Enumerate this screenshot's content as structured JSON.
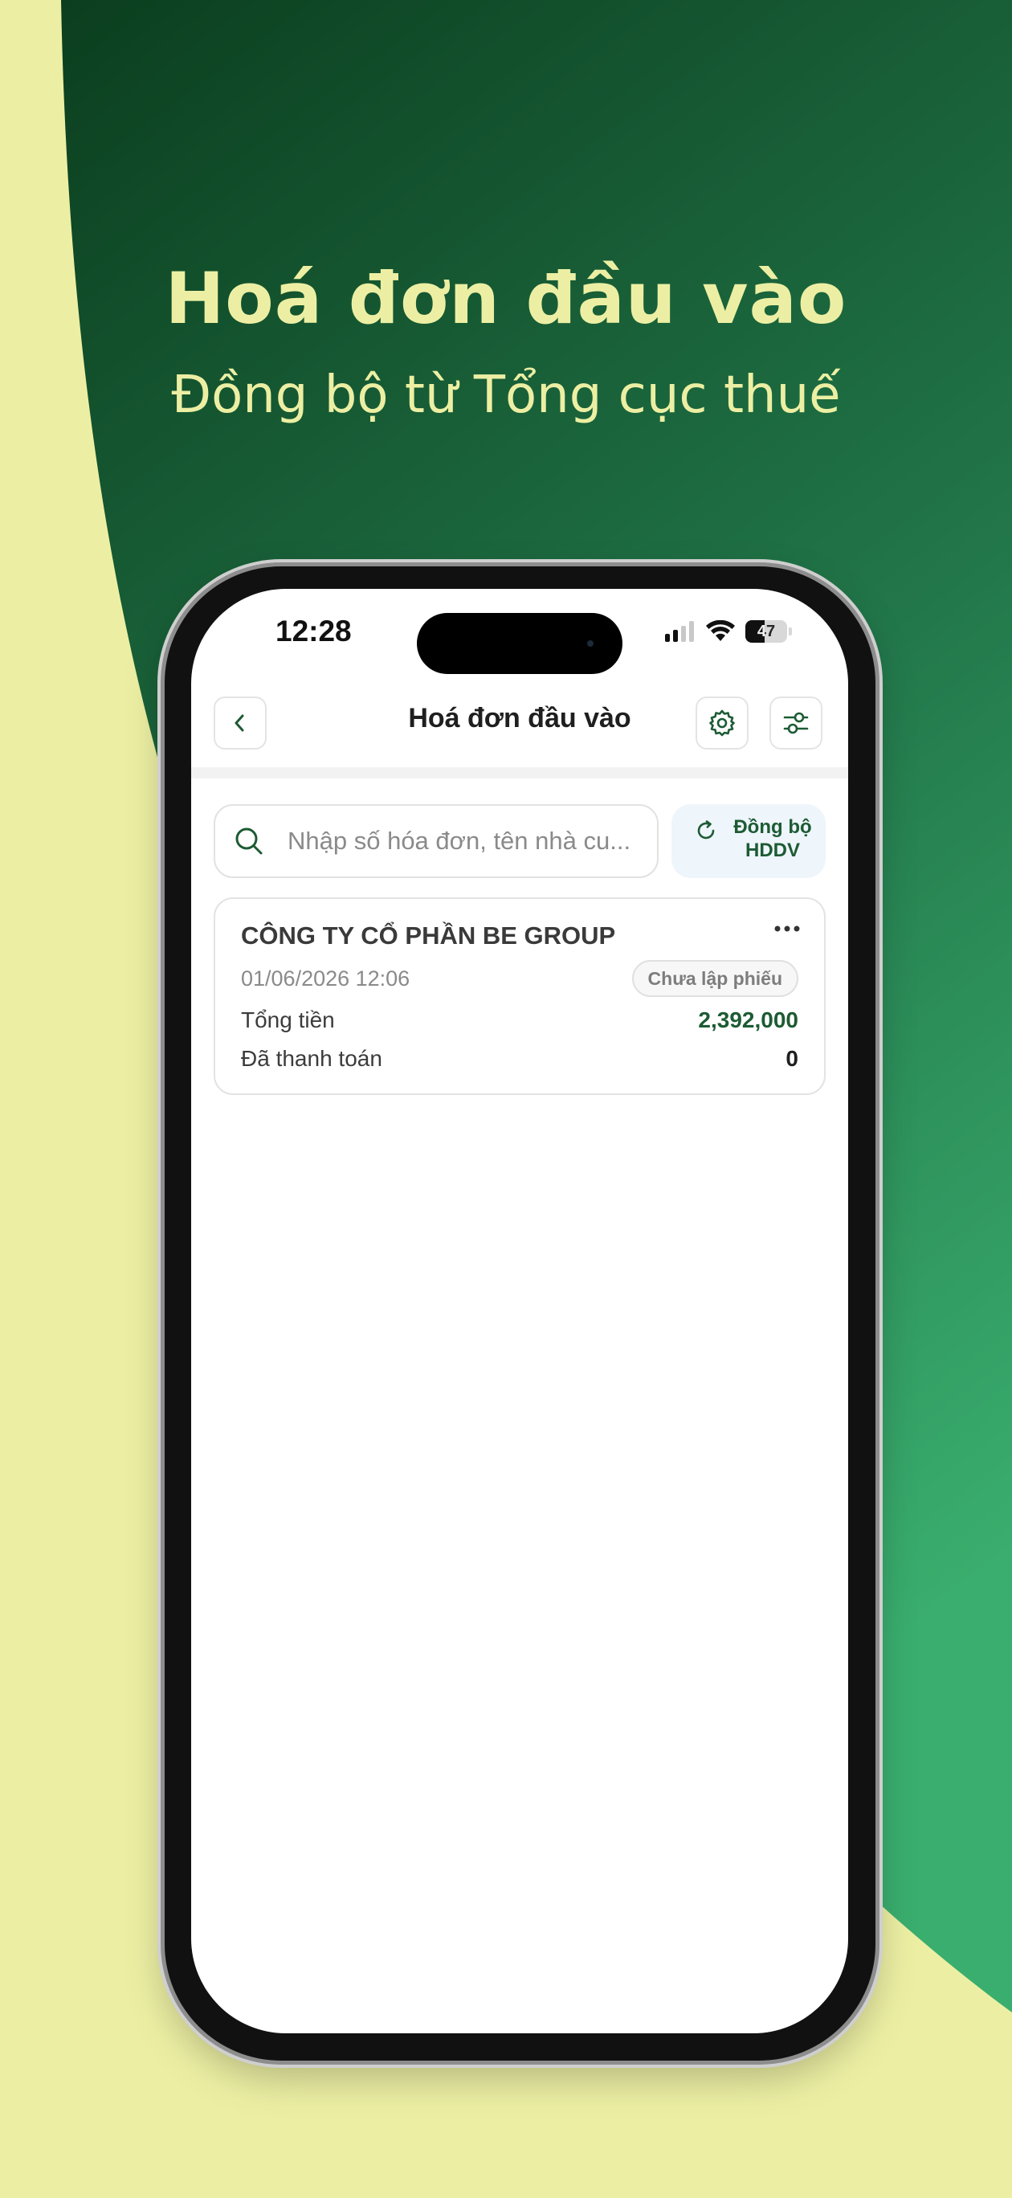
{
  "hero": {
    "title": "Hoá đơn đầu vào",
    "subtitle": "Đồng bộ từ Tổng cục thuế"
  },
  "colors": {
    "background": "#ECEFA3",
    "green_dark": "#0B3E1E",
    "green_light": "#38A96B",
    "accent_text": "#1D5B34"
  },
  "status_bar": {
    "time": "12:28",
    "battery": "47",
    "icons": [
      "signal-icon",
      "wifi-icon",
      "battery-icon"
    ]
  },
  "app": {
    "header": {
      "title": "Hoá đơn đầu vào",
      "icons": [
        "back-icon",
        "settings-icon",
        "filter-icon"
      ]
    },
    "search": {
      "placeholder": "Nhập số hóa đơn, tên nhà cu..."
    },
    "sync_button": {
      "line1": "Đồng bộ",
      "line2": "HDDV"
    },
    "invoices": [
      {
        "company": "CÔNG TY CỔ PHẦN BE GROUP",
        "datetime": "01/06/2026 12:06",
        "status": "Chưa lập phiếu",
        "total_label": "Tổng tiền",
        "total_value": "2,392,000",
        "paid_label": "Đã thanh toán",
        "paid_value": "0"
      }
    ]
  }
}
